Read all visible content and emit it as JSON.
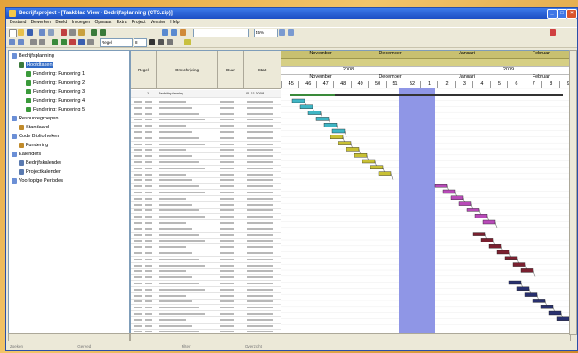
{
  "window": {
    "title": "Bedrijfsproject - [Taakblad View - Bedrijfsplanning (CTS.zip)]",
    "menu": [
      "Bestand",
      "Bewerken",
      "Beeld",
      "Invoegen",
      "Opmaak",
      "Extra",
      "Project",
      "Venster",
      "Help"
    ],
    "controls": {
      "min": "_",
      "max": "□",
      "close": "×"
    }
  },
  "toolbar": {
    "zoom_value": "45%",
    "font_value": "Regel",
    "font_size": "8"
  },
  "tree": {
    "items": [
      {
        "label": "Bedrijfsplanning",
        "level": 0,
        "icon": "folder-icon",
        "color": "#6b8fd6"
      },
      {
        "label": "Hoofdtaken",
        "level": 1,
        "icon": "tasks-icon",
        "color": "#3b7a3b",
        "selected": true
      },
      {
        "label": "Fundering: Fundering 1",
        "level": 2,
        "icon": "task-icon",
        "color": "#3a9a3a"
      },
      {
        "label": "Fundering: Fundering 2",
        "level": 2,
        "icon": "task-icon",
        "color": "#3a9a3a"
      },
      {
        "label": "Fundering: Fundering 3",
        "level": 2,
        "icon": "task-icon",
        "color": "#3a9a3a"
      },
      {
        "label": "Fundering: Fundering 4",
        "level": 2,
        "icon": "task-icon",
        "color": "#3a9a3a"
      },
      {
        "label": "Fundering: Fundering 5",
        "level": 2,
        "icon": "task-icon",
        "color": "#3a9a3a"
      },
      {
        "label": "Resourcegroepen",
        "level": 0,
        "icon": "folder-icon",
        "color": "#6b8fd6"
      },
      {
        "label": "Standaard",
        "level": 1,
        "icon": "group-icon",
        "color": "#c08a2a"
      },
      {
        "label": "Code Bibliotheken",
        "level": 0,
        "icon": "folder-icon",
        "color": "#6b8fd6"
      },
      {
        "label": "Fundering",
        "level": 1,
        "icon": "library-icon",
        "color": "#c08a2a"
      },
      {
        "label": "Kalenders",
        "level": 0,
        "icon": "folder-icon",
        "color": "#6b8fd6"
      },
      {
        "label": "Bedrijfskalender",
        "level": 1,
        "icon": "calendar-icon",
        "color": "#5a7ab0"
      },
      {
        "label": "Projectkalender",
        "level": 1,
        "icon": "calendar-icon",
        "color": "#5a7ab0"
      },
      {
        "label": "Voorlopige Periodes",
        "level": 0,
        "icon": "period-icon",
        "color": "#6b8fd6"
      }
    ]
  },
  "grid": {
    "columns": [
      "Regel",
      "Omschrijving",
      "Duur",
      "Start"
    ],
    "summary_row": {
      "num": "1",
      "desc": "Bedrijfsplanning",
      "start": "01-11-2008"
    }
  },
  "gantt": {
    "months_top": [
      "November",
      "December",
      "Januari",
      "Februari"
    ],
    "years": [
      "2008",
      "2009"
    ],
    "months_mid": [
      "November",
      "December",
      "Januari",
      "Februari"
    ],
    "weeks": [
      "45",
      "46",
      "47",
      "48",
      "49",
      "50",
      "51",
      "52",
      "1",
      "2",
      "3",
      "4",
      "5",
      "6",
      "7",
      "8",
      "9"
    ]
  },
  "status": {
    "items": [
      "Zoeken",
      "Gereed",
      "Filter",
      "Overzicht"
    ]
  },
  "colors": {
    "header_olive": "#c8c070",
    "band_blue": "#8f96e6",
    "bar_teal": "#3fb5c4",
    "bar_yellow": "#c8c034",
    "bar_magenta": "#b84ab8",
    "bar_maroon": "#7a2030",
    "bar_navy": "#28306e",
    "bar_green": "#3a8a3a"
  }
}
